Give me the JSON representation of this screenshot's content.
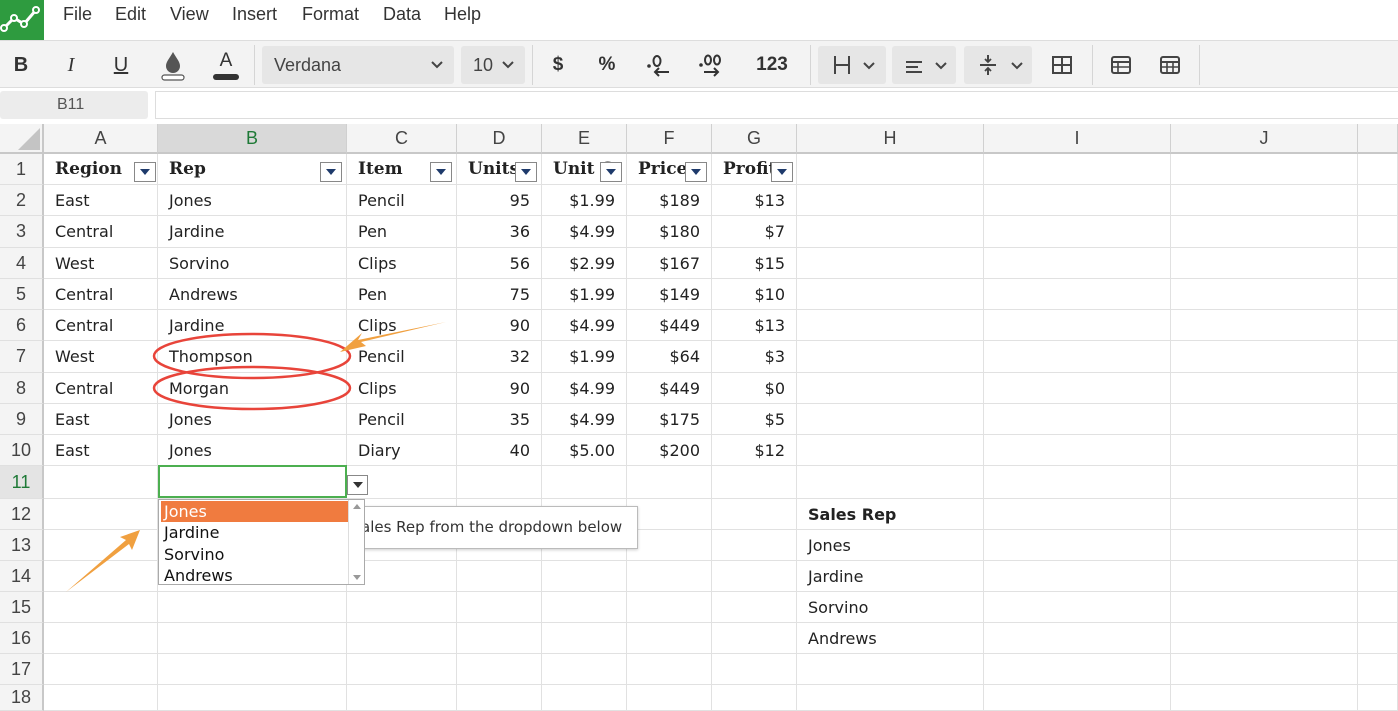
{
  "app": {
    "logo_icon": "spreadsheet-logo-icon",
    "brand_color": "#2e9b3f"
  },
  "menu": [
    "File",
    "Edit",
    "View",
    "Insert",
    "Format",
    "Data",
    "Help"
  ],
  "toolbar": {
    "bold": "B",
    "italic": "I",
    "underline": "U",
    "text_color": "A",
    "font": "Verdana",
    "size": "10",
    "currency": "$",
    "percent": "%",
    "number": "123"
  },
  "formula_bar": {
    "name_box": "B11",
    "formula": ""
  },
  "columns": [
    "A",
    "B",
    "C",
    "D",
    "E",
    "F",
    "G",
    "H",
    "I",
    "J"
  ],
  "rows": [
    "1",
    "2",
    "3",
    "4",
    "5",
    "6",
    "7",
    "8",
    "9",
    "10",
    "11",
    "12",
    "13",
    "14",
    "15",
    "16",
    "17",
    "18"
  ],
  "table": {
    "headers": [
      "Region",
      "Rep",
      "Item",
      "Units",
      "Unit C",
      "Price",
      "Profits"
    ],
    "data": [
      [
        "East",
        "Jones",
        "Pencil",
        "95",
        "$1.99",
        "$189",
        "$13"
      ],
      [
        "Central",
        "Jardine",
        "Pen",
        "36",
        "$4.99",
        "$180",
        "$7"
      ],
      [
        "West",
        "Sorvino",
        "Clips",
        "56",
        "$2.99",
        "$167",
        "$15"
      ],
      [
        "Central",
        "Andrews",
        "Pen",
        "75",
        "$1.99",
        "$149",
        "$10"
      ],
      [
        "Central",
        "Jardine",
        "Clips",
        "90",
        "$4.99",
        "$449",
        "$13"
      ],
      [
        "West",
        "Thompson",
        "Pencil",
        "32",
        "$1.99",
        "$64",
        "$3"
      ],
      [
        "Central",
        "Morgan",
        "Clips",
        "90",
        "$4.99",
        "$449",
        "$0"
      ],
      [
        "East",
        "Jones",
        "Pencil",
        "35",
        "$4.99",
        "$175",
        "$5"
      ],
      [
        "East",
        "Jones",
        "Diary",
        "40",
        "$5.00",
        "$200",
        "$12"
      ]
    ]
  },
  "sales_rep": {
    "header": "Sales Rep",
    "items": [
      "Jones",
      "Jardine",
      "Sorvino",
      "Andrews"
    ]
  },
  "dropdown": {
    "options": [
      "Jones",
      "Jardine",
      "Sorvino",
      "Andrews"
    ],
    "highlighted": "Jones",
    "highlight_color": "#f07b3f"
  },
  "tooltip": {
    "text": "ales Rep from the dropdown below"
  },
  "annotation_colors": {
    "circle": "#e8443a",
    "arrow": "#f0a040"
  }
}
